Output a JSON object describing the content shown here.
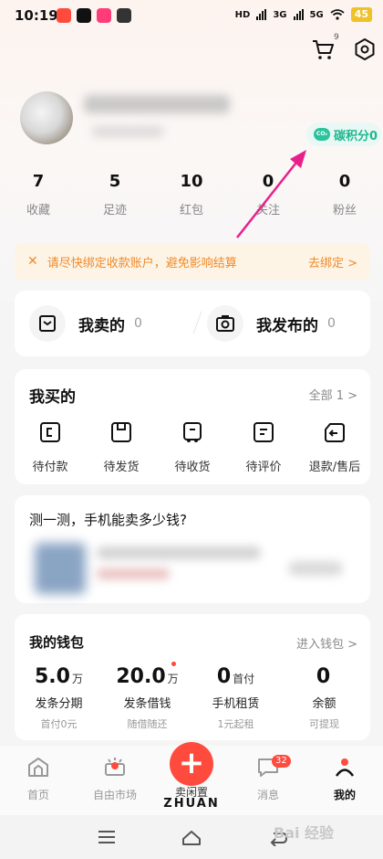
{
  "status_bar": {
    "time": "10:19",
    "signal_labels": [
      "HD",
      "3G",
      "5G"
    ],
    "battery": "45"
  },
  "header": {
    "cart_badge": "9"
  },
  "profile": {
    "carbon_label": "碳积分0",
    "carbon_icon_text": "CO₂"
  },
  "stats": [
    {
      "value": "7",
      "label": "收藏"
    },
    {
      "value": "5",
      "label": "足迹"
    },
    {
      "value": "10",
      "label": "红包"
    },
    {
      "value": "0",
      "label": "关注"
    },
    {
      "value": "0",
      "label": "粉丝"
    }
  ],
  "notice": {
    "message": "请尽快绑定收款账户，避免影响结算",
    "action": "去绑定 >"
  },
  "sell_publish": [
    {
      "title": "我卖的",
      "count": "0"
    },
    {
      "title": "我发布的",
      "count": "0"
    }
  ],
  "bought": {
    "title": "我买的",
    "all_label": "全部 1 >",
    "items": [
      {
        "label": "待付款",
        "icon": "wallet-icon"
      },
      {
        "label": "待发货",
        "icon": "box-icon"
      },
      {
        "label": "待收货",
        "icon": "truck-icon"
      },
      {
        "label": "待评价",
        "icon": "comment-icon"
      },
      {
        "label": "退款/售后",
        "icon": "refund-icon"
      }
    ]
  },
  "estimate": {
    "title": "测一测，手机能卖多少钱?"
  },
  "wallet": {
    "title": "我的钱包",
    "enter_label": "进入钱包 >",
    "items": [
      {
        "value": "5.0",
        "unit": "万",
        "label": "发条分期",
        "sub": "首付0元"
      },
      {
        "value": "20.0",
        "unit": "万",
        "label": "发条借钱",
        "sub": "随借随还"
      },
      {
        "value": "0",
        "unit": "首付",
        "label": "手机租赁",
        "sub": "1元起租"
      },
      {
        "value": "0",
        "unit": "",
        "label": "余额",
        "sub": "可提现"
      }
    ]
  },
  "bottom_nav": {
    "home": "首页",
    "market": "自由市场",
    "sell": "卖闲置",
    "brand": "ZHUAN",
    "messages": "消息",
    "messages_badge": "32",
    "mine": "我的"
  },
  "watermark": "Bai 经验"
}
